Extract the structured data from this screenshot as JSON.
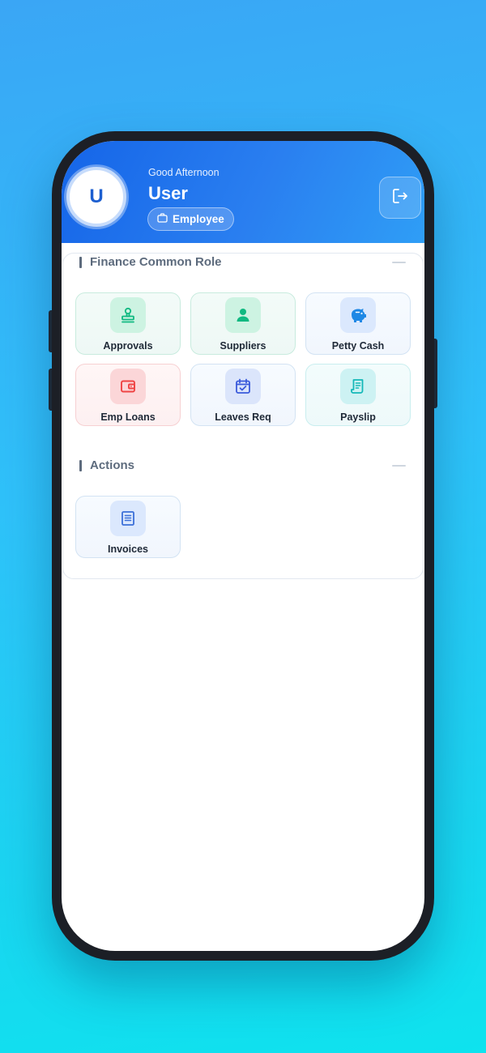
{
  "header": {
    "avatar_initial": "U",
    "greeting": "Good Afternoon",
    "user_name": "User",
    "role": "Employee",
    "role_icon": "briefcase-icon",
    "logout_icon": "logout-icon"
  },
  "sections": [
    {
      "title": "Finance Common Role",
      "tiles": [
        {
          "label": "Approvals",
          "icon": "stamp-icon",
          "color": "#10b981"
        },
        {
          "label": "Suppliers",
          "icon": "person-icon",
          "color": "#10b981"
        },
        {
          "label": "Petty Cash",
          "icon": "piggy-bank-icon",
          "color": "#1e88e5"
        },
        {
          "label": "Emp Loans",
          "icon": "wallet-icon",
          "color": "#ef4444"
        },
        {
          "label": "Leaves Req",
          "icon": "calendar-check-icon",
          "color": "#3b5bdb"
        },
        {
          "label": "Payslip",
          "icon": "receipt-icon",
          "color": "#14b8b8"
        }
      ]
    },
    {
      "title": "Actions",
      "tiles": [
        {
          "label": "Invoices",
          "icon": "document-lines-icon",
          "color": "#3b6fd8"
        }
      ]
    }
  ],
  "colors": {
    "header_start": "#1565e8",
    "header_end": "#2f9ef6",
    "section_title": "#5d6b7d"
  }
}
